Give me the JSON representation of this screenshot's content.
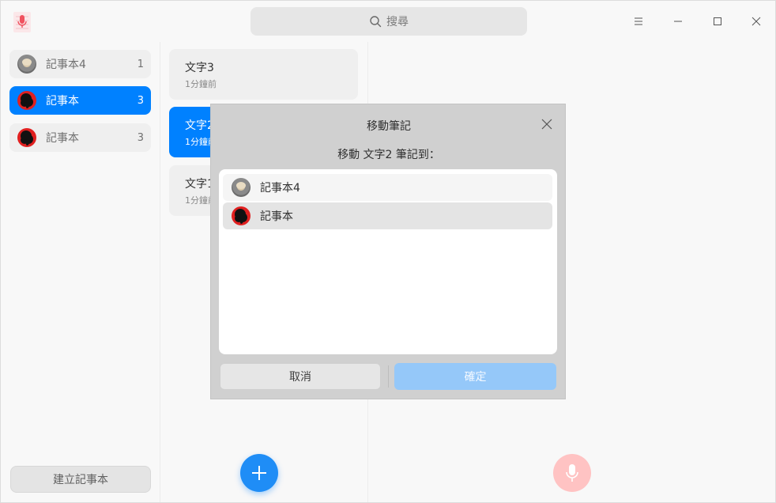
{
  "titlebar": {
    "search_placeholder": "搜尋",
    "app_icon": "voice-note-icon",
    "menu_icon": "menu-icon",
    "minimize_icon": "minimize-icon",
    "maximize_icon": "maximize-icon",
    "close_icon": "close-icon"
  },
  "sidebar": {
    "notebooks": [
      {
        "name": "記事本4",
        "count": "1",
        "avatar": "gray-cat",
        "active": false
      },
      {
        "name": "記事本",
        "count": "3",
        "avatar": "red-tree",
        "active": true
      },
      {
        "name": "記事本",
        "count": "3",
        "avatar": "red-tree",
        "active": false
      }
    ],
    "create_label": "建立記事本"
  },
  "notes": [
    {
      "title": "文字3",
      "time": "1分鐘前",
      "active": false
    },
    {
      "title": "文字2",
      "time": "1分鐘前",
      "active": true
    },
    {
      "title": "文字1",
      "time": "1分鐘前",
      "active": false
    }
  ],
  "dialog": {
    "title": "移動筆記",
    "message": "移動 文字2 筆記到：",
    "targets": [
      {
        "name": "記事本4",
        "avatar": "gray-cat",
        "selected": false
      },
      {
        "name": "記事本",
        "avatar": "red-tree",
        "selected": true
      }
    ],
    "cancel_label": "取消",
    "confirm_label": "確定"
  },
  "colors": {
    "accent": "#0081ff",
    "disabled_accent": "#95c8f9",
    "mic_button": "#ffc3c3"
  }
}
